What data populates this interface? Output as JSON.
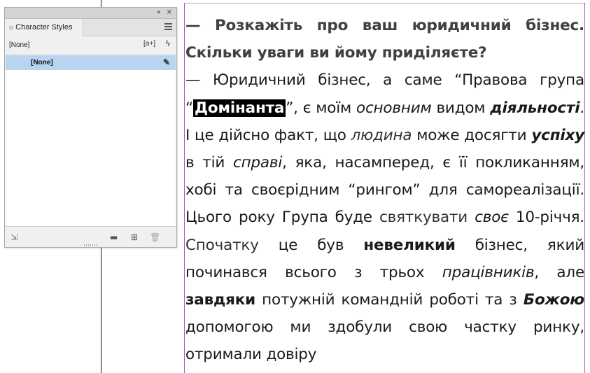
{
  "panel": {
    "collapse_icon": "«",
    "close_icon": "×",
    "tab_label": "Character Styles",
    "current_style": "[None]",
    "new_from_label": "[a+]",
    "selected_style": "[None]"
  },
  "story": {
    "q_part1": "— Розкажіть про ваш юридичний бізнес. Скільки уваги ви йому приділяєте?",
    "p1": "— Юридичний бізнес, а саме “Правова група “",
    "p_dominanta": "Домінанта",
    "p2": "”, є моїм ",
    "p_osnovnym": "основним",
    "p3": " видом ",
    "p_diyalnosti": "діяльності",
    "p4": ". І це дійсно факт, що ",
    "p_lyudyna": "людина",
    "p5": " може досягти ",
    "p_uspikhu": "успіху",
    "p6": " в тій ",
    "p_spravi": "справі",
    "p7": ", яка, насамперед, є її покликанням, хобі та своєрідним “рингом” для самореалізації. Цього року Група буде ",
    "p_svyatkuvaty": "святкувати",
    "p8": " ",
    "p_svoye": "своє",
    "p9": " 10-річчя. ",
    "p_spochatku": "Спочатку",
    "p10": " це був ",
    "p_nevelykyi": "невеликий",
    "p11": " бізнес, який починався всього з трьох ",
    "p_pratsivnykiv": "працівників",
    "p12": ", але ",
    "p_zavdyaky": "завдяки",
    "p13": " потужній командній роботі та з ",
    "p_bozhoyu": "Божою",
    "p14": " допомогою ми здобули свою частку ринку, отримали довіру"
  }
}
